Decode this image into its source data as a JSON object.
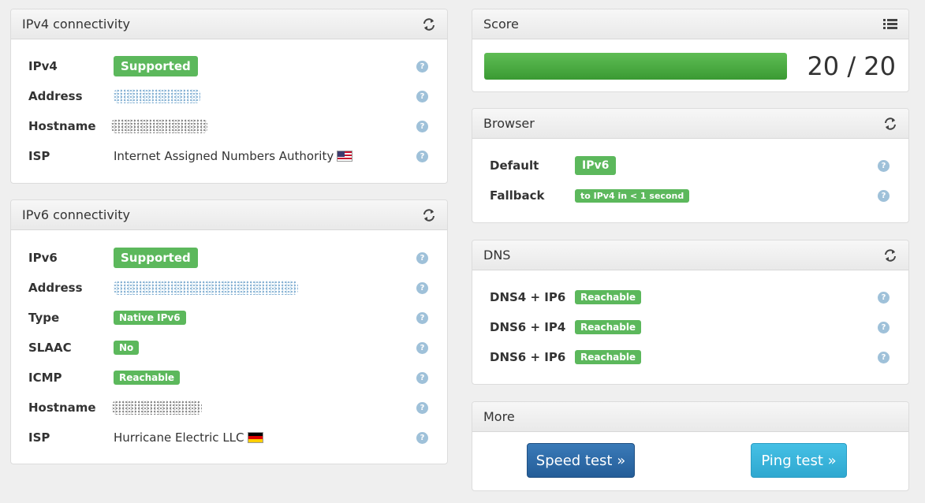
{
  "ipv4": {
    "title": "IPv4 connectivity",
    "rows": [
      {
        "label": "IPv4",
        "badge": "Supported"
      },
      {
        "label": "Address"
      },
      {
        "label": "Hostname"
      },
      {
        "label": "ISP",
        "value": "Internet Assigned Numbers Authority"
      }
    ]
  },
  "ipv6": {
    "title": "IPv6 connectivity",
    "rows": [
      {
        "label": "IPv6",
        "badge": "Supported"
      },
      {
        "label": "Address"
      },
      {
        "label": "Type",
        "badge": "Native IPv6"
      },
      {
        "label": "SLAAC",
        "badge": "No"
      },
      {
        "label": "ICMP",
        "badge": "Reachable"
      },
      {
        "label": "Hostname"
      },
      {
        "label": "ISP",
        "value": "Hurricane Electric LLC"
      }
    ]
  },
  "score": {
    "title": "Score",
    "text": "20 / 20",
    "fraction": 1.0
  },
  "browser": {
    "title": "Browser",
    "rows": [
      {
        "label": "Default",
        "badge": "IPv6"
      },
      {
        "label": "Fallback",
        "badge": "to IPv4 in < 1 second"
      }
    ]
  },
  "dns": {
    "title": "DNS",
    "rows": [
      {
        "label": "DNS4 + IP6",
        "badge": "Reachable"
      },
      {
        "label": "DNS6 + IP4",
        "badge": "Reachable"
      },
      {
        "label": "DNS6 + IP6",
        "badge": "Reachable"
      }
    ]
  },
  "more": {
    "title": "More",
    "speed_button": "Speed test »",
    "ping_button": "Ping test »"
  },
  "help_glyph": "?",
  "colors": {
    "success": "#5cb85c",
    "primary": "#2d6ca8",
    "info": "#3ab5dc",
    "help": "#9fc1d9"
  }
}
